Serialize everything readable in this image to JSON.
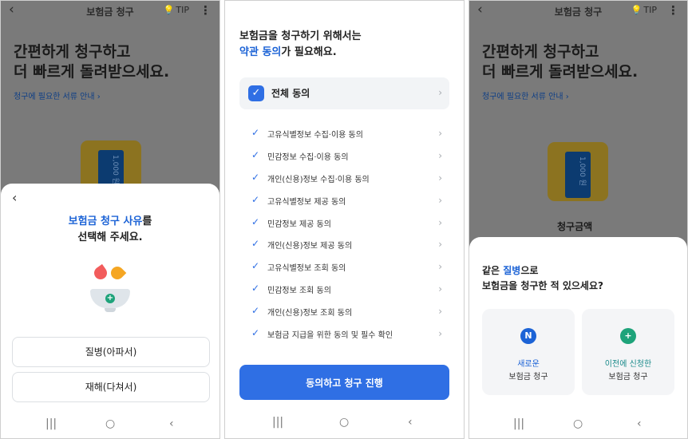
{
  "screen1": {
    "appbar": {
      "back": "‹",
      "title": "보험금 청구",
      "tip": "TIP",
      "more": "⋮"
    },
    "headline_1": "간편하게 청구하고",
    "headline_2": "더 빠르게 돌려받으세요.",
    "docs_link": "청구에 필요한 서류 안내 ›",
    "coin_label": "1,000 원",
    "sheet": {
      "back": "‹",
      "title_highlight": "보험금 청구 사유",
      "title_rest": "를",
      "title_line2": "선택해 주세요.",
      "options": [
        "질병(아파서)",
        "재해(다쳐서)"
      ]
    }
  },
  "screen2": {
    "headline_1": "보험금을 청구하기 위해서는",
    "headline_highlight": "약관 동의",
    "headline_rest": "가 필요해요.",
    "all_agree": "전체 동의",
    "terms": [
      "고유식별정보 수집·이용 동의",
      "민감정보 수집·이용 동의",
      "개인(신용)정보 수집·이용 동의",
      "고유식별정보 제공 동의",
      "민감정보 제공 동의",
      "개인(신용)정보 제공 동의",
      "고유식별정보 조회 동의",
      "민감정보 조회 동의",
      "개인(신용)정보 조회 동의",
      "보험금 지급을 위한 동의 및 필수 확인"
    ],
    "cta": "동의하고 청구 진행"
  },
  "screen3": {
    "appbar": {
      "back": "‹",
      "title": "보험금 청구",
      "tip": "TIP",
      "more": "⋮"
    },
    "headline_1": "간편하게 청구하고",
    "headline_2": "더 빠르게 돌려받으세요.",
    "docs_link": "청구에 필요한 서류 안내 ›",
    "coin_label": "1,000 원",
    "amount_label": "청구금액",
    "sheet": {
      "title_prefix": "같은 ",
      "title_highlight": "질병",
      "title_rest": "으로",
      "title_line2": "보험금을 청구한 적 있으세요?",
      "card_new": {
        "icon": "N",
        "line1": "새로운",
        "line2": "보험금 청구"
      },
      "card_prev": {
        "icon": "+",
        "line1": "이전에 신청한",
        "line2": "보험금 청구"
      }
    }
  },
  "navbar": {
    "recents": "|||",
    "home": "○",
    "back": "‹"
  },
  "colors": {
    "primary": "#2f6fe4",
    "highlight_blue": "#1c63d6",
    "green": "#1ea37a",
    "teal": "#1a8a8a"
  }
}
